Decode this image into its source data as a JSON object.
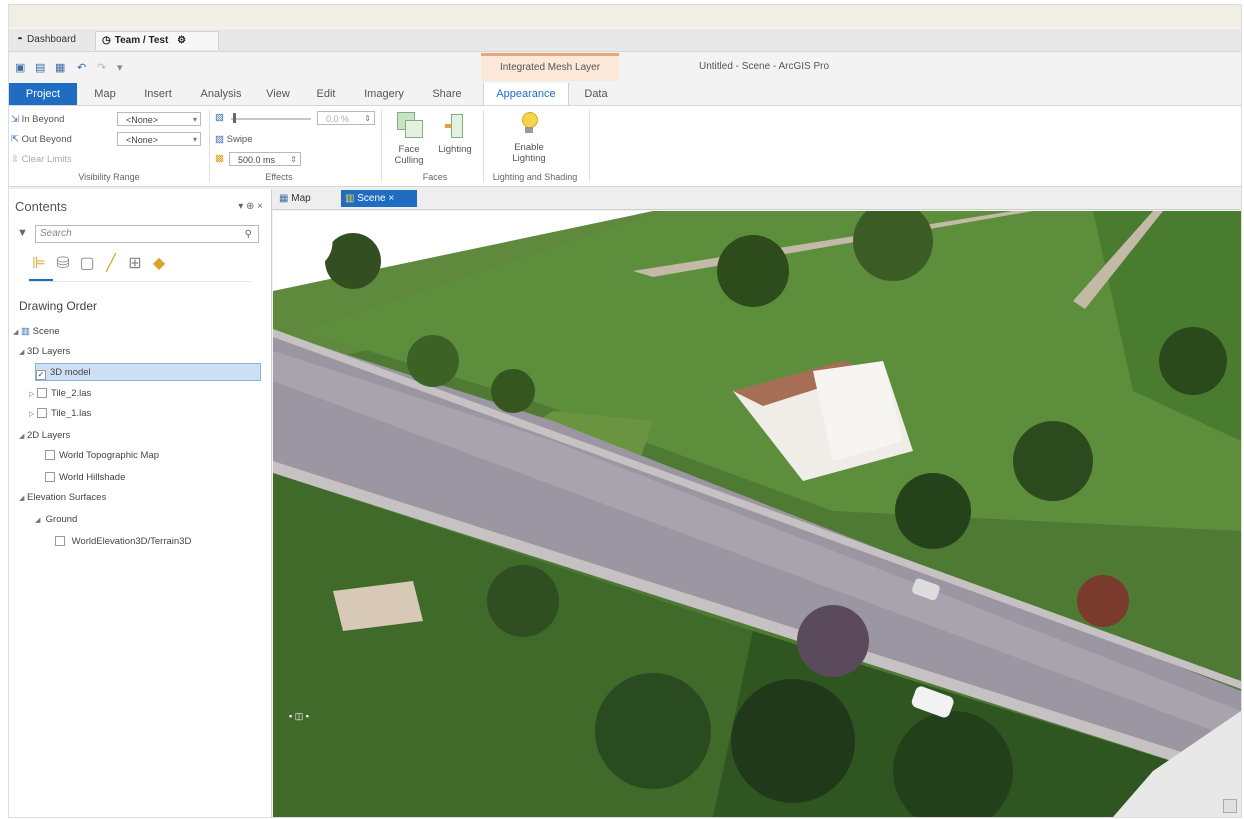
{
  "browser": {
    "tabs": [
      {
        "label": "Dashboard",
        "icon": "dashboard-icon"
      },
      {
        "label": "Team / Test",
        "icon": "clock-icon",
        "trailing_icon": "settings-icon"
      }
    ]
  },
  "app": {
    "title": "Untitled - Scene - ArcGIS Pro",
    "context_group": "Integrated Mesh Layer"
  },
  "ribbon_tabs": [
    "Project",
    "Map",
    "Insert",
    "Analysis",
    "View",
    "Edit",
    "Imagery",
    "Share",
    "Appearance",
    "Data"
  ],
  "ribbon": {
    "visibility": {
      "in_beyond_label": "In Beyond",
      "in_beyond_value": "<None>",
      "out_beyond_label": "Out Beyond",
      "out_beyond_value": "<None>",
      "clear_limits": "Clear Limits",
      "group": "Visibility Range"
    },
    "effects": {
      "transparency_value": "0.0 %",
      "swipe_label": "Swipe",
      "flicker_value": "500.0 ms",
      "group": "Effects"
    },
    "faces": {
      "face_culling": "Face Culling",
      "lighting": "Lighting",
      "group": "Faces"
    },
    "lighting_shading": {
      "enable_lighting": "Enable Lighting",
      "group": "Lighting and Shading"
    }
  },
  "view_tabs": [
    {
      "label": "Map"
    },
    {
      "label": "Scene",
      "close": "×"
    }
  ],
  "contents": {
    "title": "Contents",
    "controls": "▾ ⊕ ×",
    "search_placeholder": "Search",
    "drawing_order": "Drawing Order",
    "tree": [
      {
        "label": "Scene"
      },
      {
        "label": "3D Layers"
      },
      {
        "label": "3D model",
        "checked": true,
        "selected": true
      },
      {
        "label": "Tile_2.las",
        "checked": false
      },
      {
        "label": "Tile_1.las",
        "checked": false
      },
      {
        "label": "2D Layers"
      },
      {
        "label": "World Topographic Map",
        "checked": false
      },
      {
        "label": "World Hillshade",
        "checked": false
      },
      {
        "label": "Elevation Surfaces"
      },
      {
        "label": "Ground"
      },
      {
        "label": "WorldElevation3D/Terrain3D",
        "checked": false
      }
    ]
  },
  "colors": {
    "accent": "#1f6dc2",
    "context_tab": "#fbe8d9",
    "selection": "#cde0f3"
  }
}
